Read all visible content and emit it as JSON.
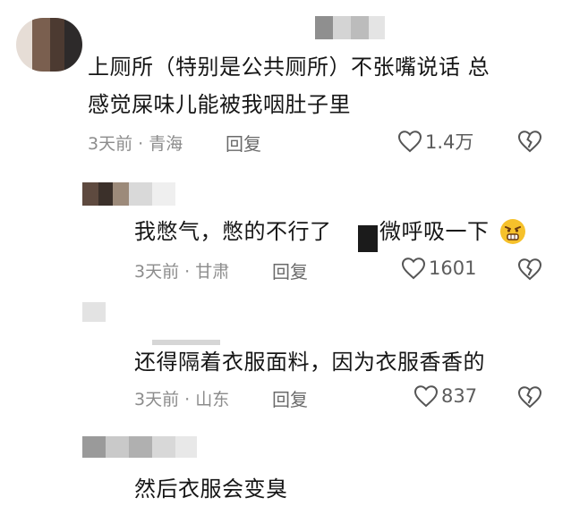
{
  "comments": [
    {
      "text_line1": "上厕所（特别是公共厕所）不张嘴说话 总",
      "text_line2": "感觉屎味儿能被我咽肚子里",
      "time_location": "3天前 · 青海",
      "reply_label": "回复",
      "like_count": "1.4万"
    },
    {
      "text_before": "我憋气，憋的不行了",
      "text_after": "微呼吸一下",
      "time_location": "3天前 · 甘肃",
      "reply_label": "回复",
      "like_count": "1601",
      "emoji": "grimace-emoji"
    },
    {
      "text": "还得隔着衣服面料，因为衣服香香的",
      "time_location": "3天前 · 山东",
      "reply_label": "回复",
      "like_count": "837"
    },
    {
      "text": "然后衣服会变臭"
    }
  ],
  "icons": {
    "like": "heart-outline-icon",
    "dislike": "broken-heart-icon"
  },
  "colors": {
    "text": "#161616",
    "meta": "#8c8c8c",
    "icon": "#555555"
  }
}
